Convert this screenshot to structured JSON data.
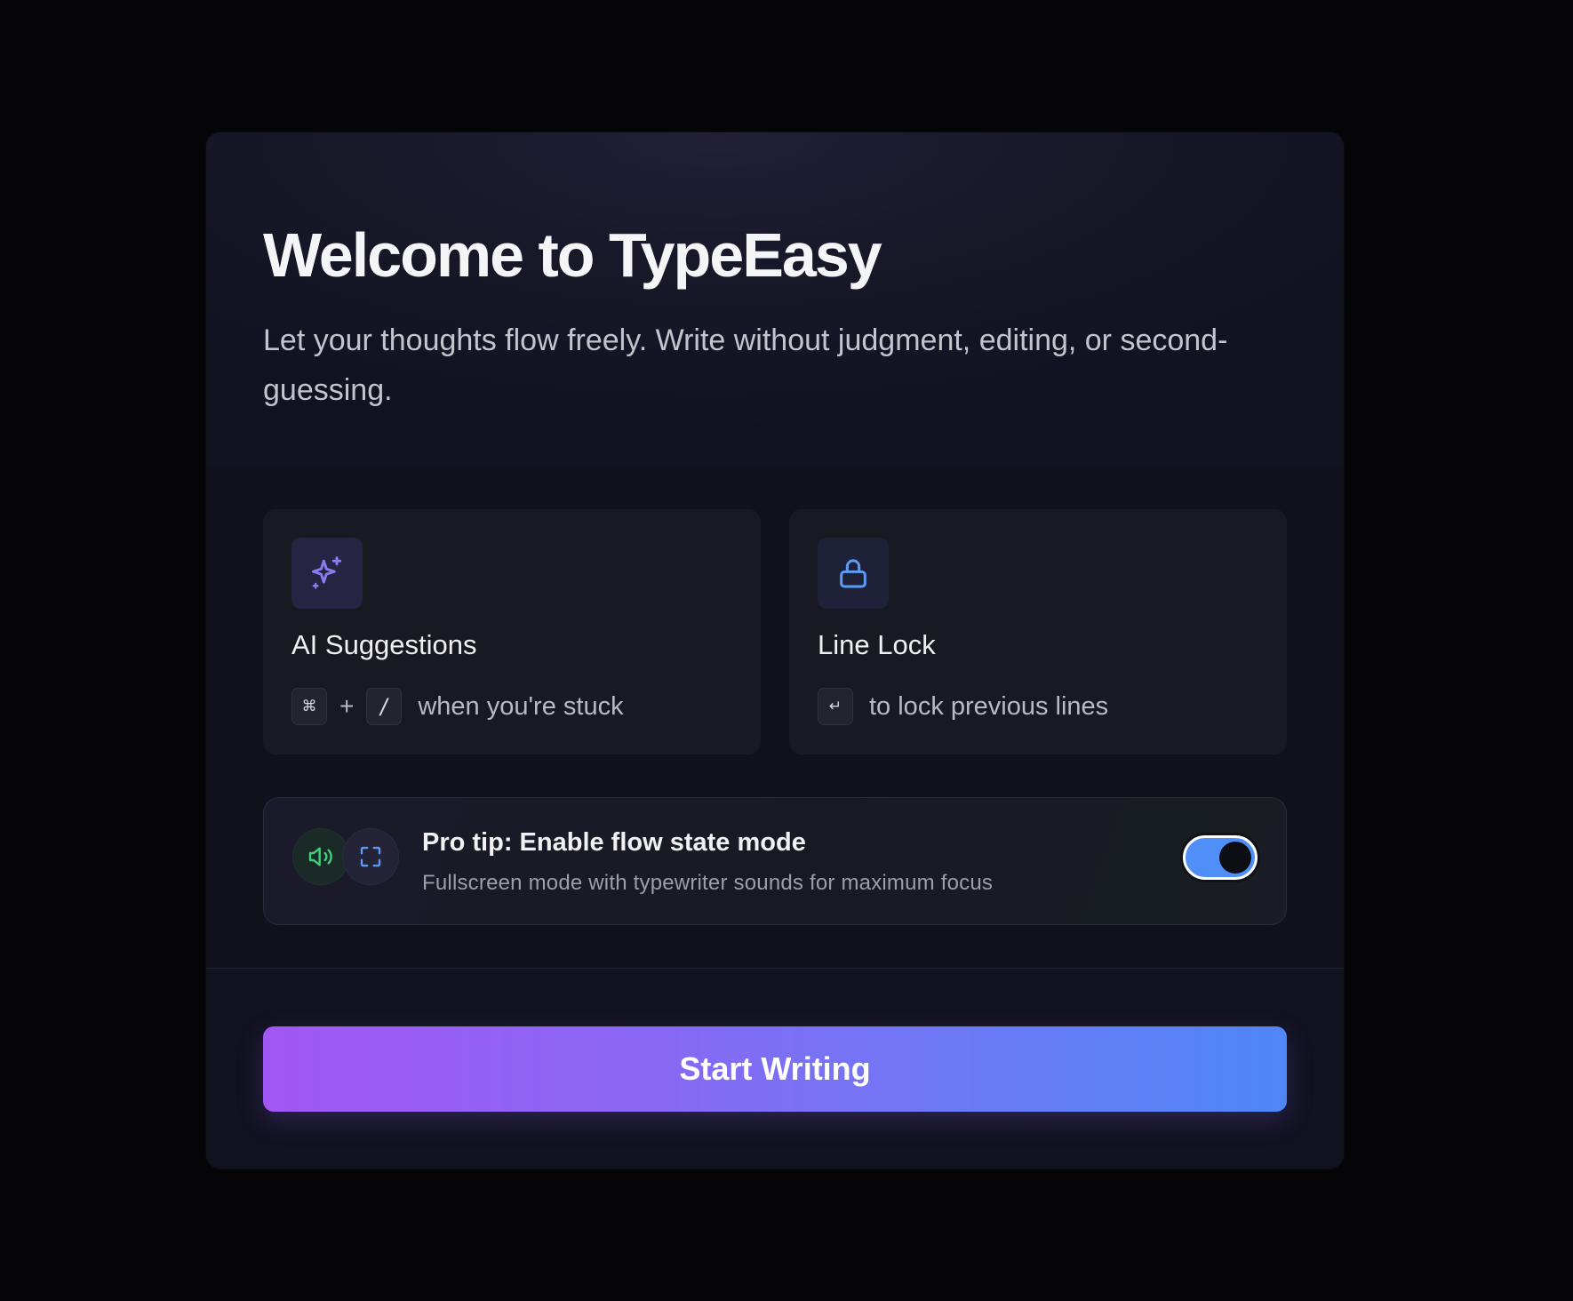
{
  "header": {
    "title": "Welcome to TypeEasy",
    "subtitle": "Let your thoughts flow freely. Write without judgment, editing, or second-guessing."
  },
  "features": [
    {
      "icon": "sparkles-icon",
      "title": "AI Suggestions",
      "keys": [
        "⌘",
        "/"
      ],
      "key_separator": "+",
      "hint": "when you're stuck"
    },
    {
      "icon": "lock-icon",
      "title": "Line Lock",
      "keys": [
        "↵"
      ],
      "hint": "to lock previous lines"
    }
  ],
  "protip": {
    "icons": [
      "speaker-icon",
      "fullscreen-icon"
    ],
    "title": "Pro tip: Enable flow state mode",
    "description": "Fullscreen mode with typewriter sounds for maximum focus",
    "toggle_on": true
  },
  "footer": {
    "start_label": "Start Writing"
  },
  "colors": {
    "accent_purple": "#a257f4",
    "accent_blue": "#4f86f6",
    "toggle_on": "#4f8ff7",
    "sound_green": "#3fcf7f",
    "sparkle_purple": "#8b7cf0",
    "lock_blue": "#5b9bf5"
  }
}
